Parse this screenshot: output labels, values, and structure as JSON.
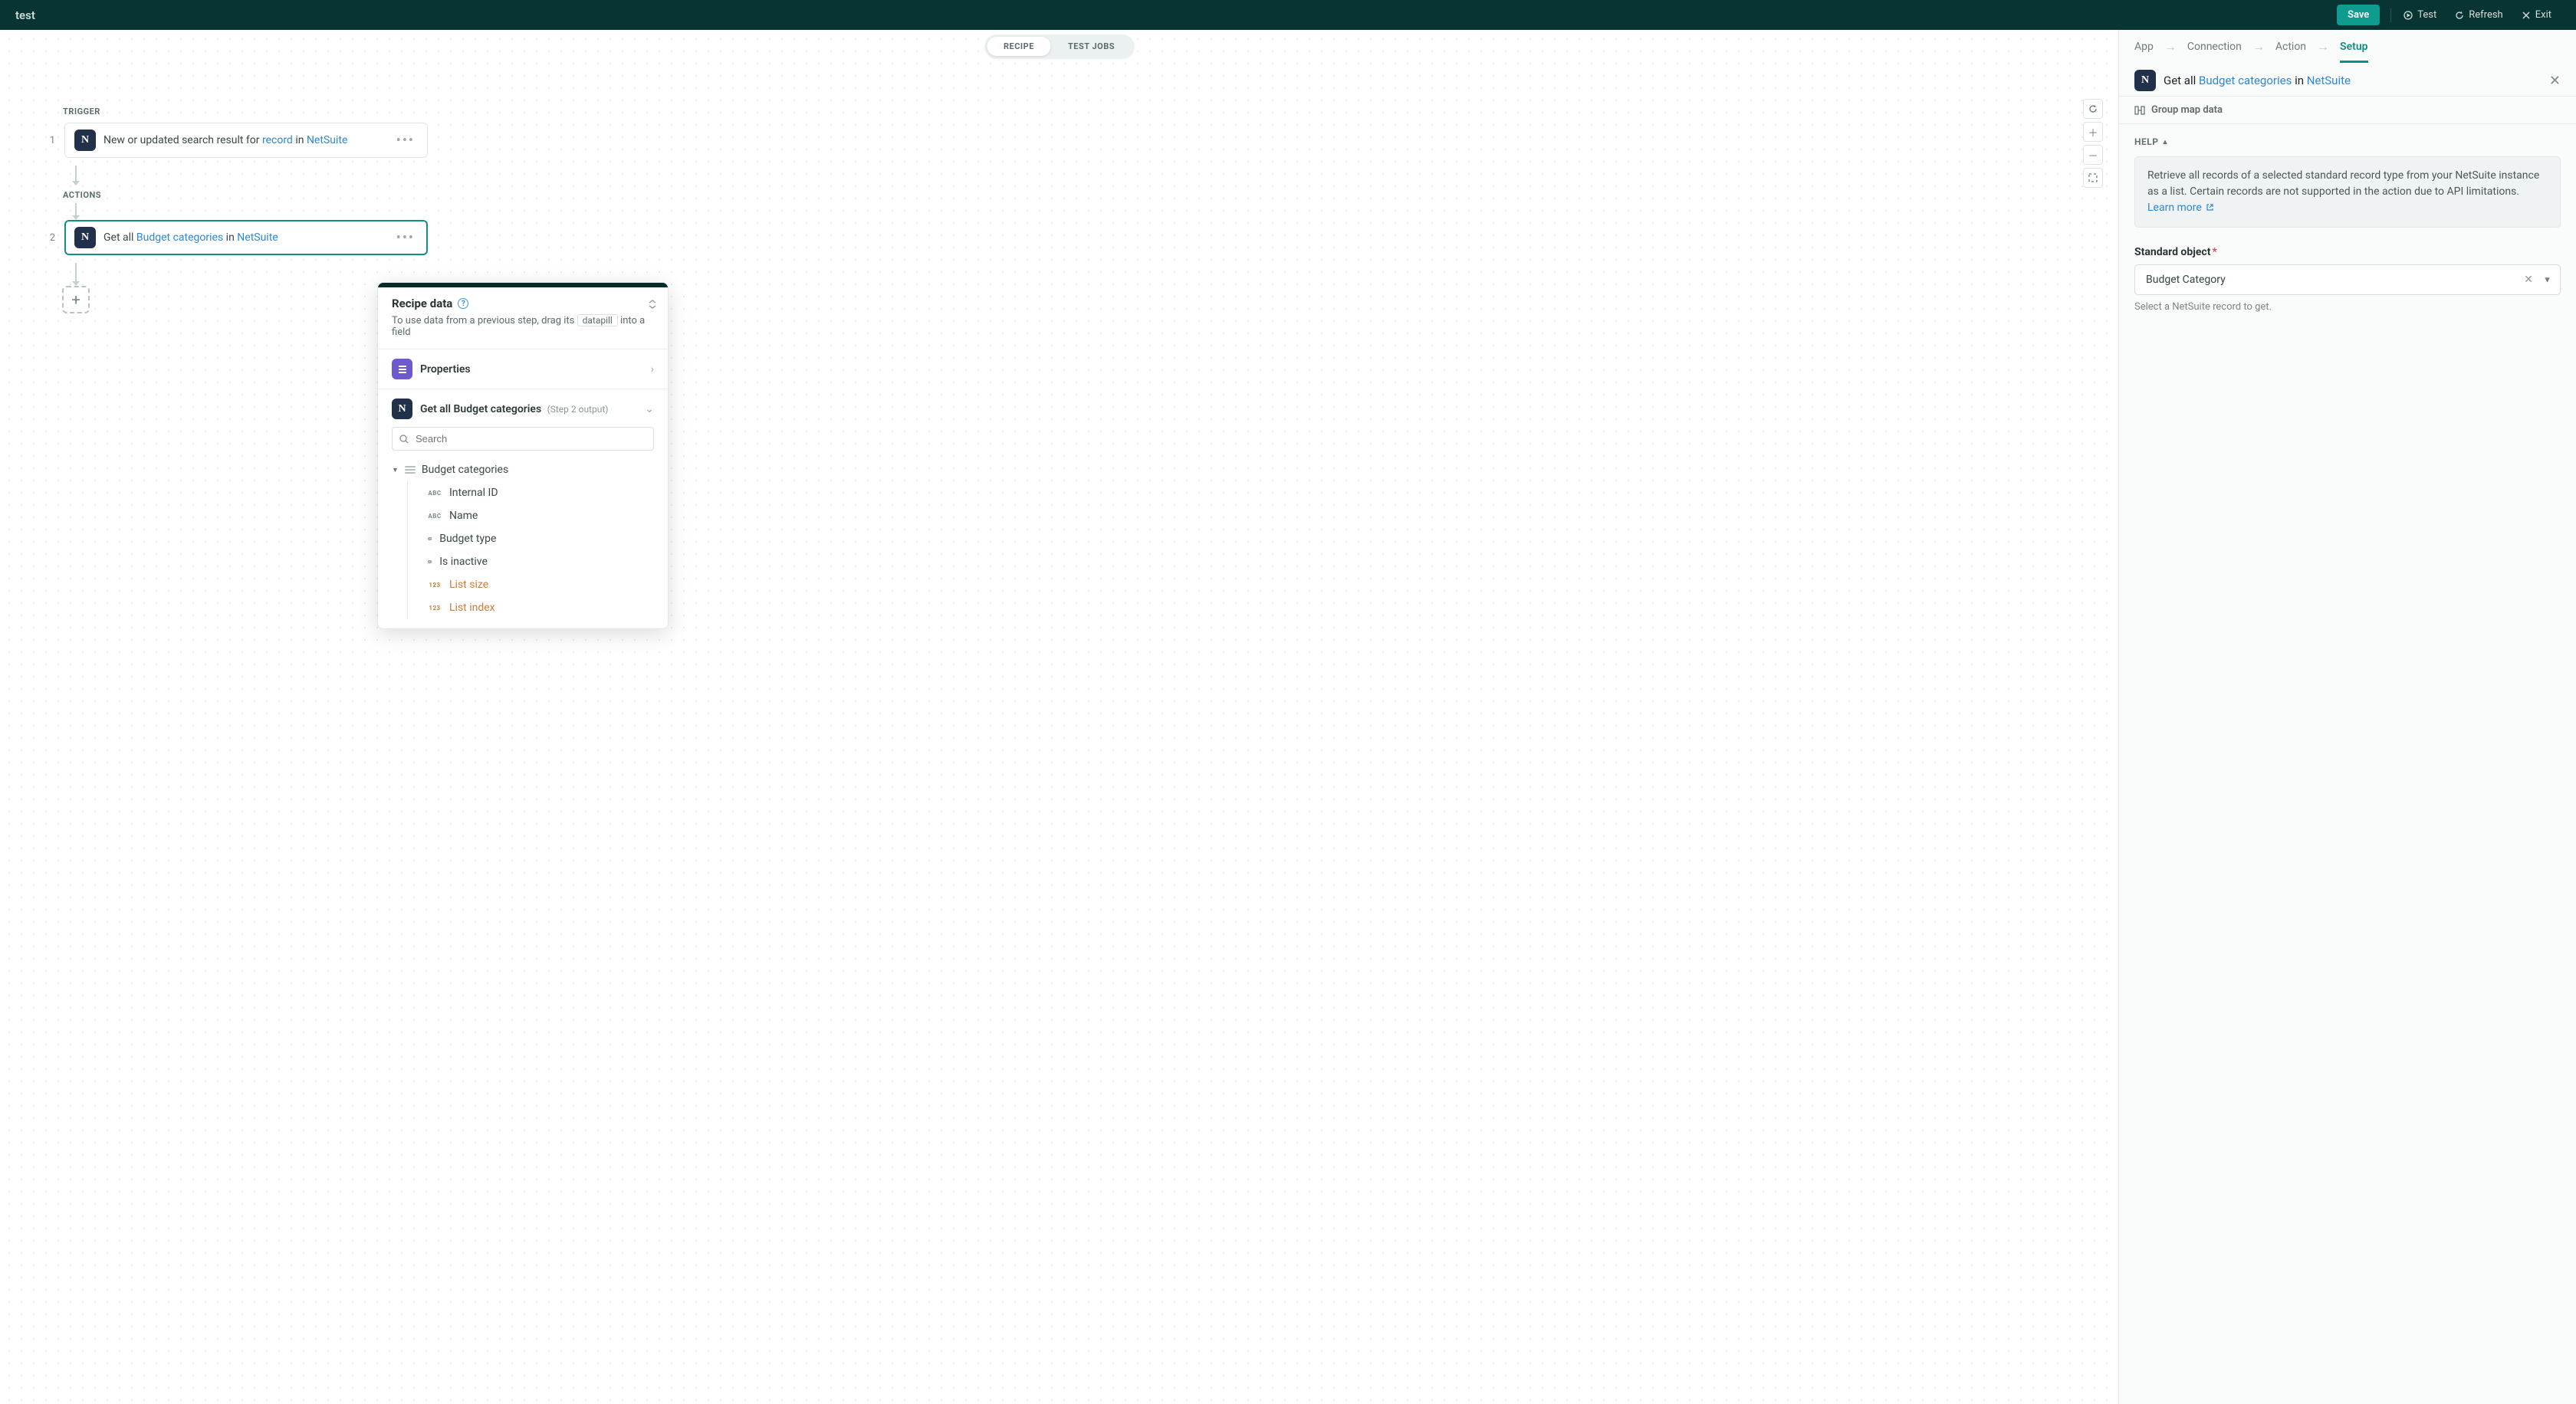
{
  "header": {
    "title": "test",
    "save": "Save",
    "test": "Test",
    "refresh": "Refresh",
    "exit": "Exit"
  },
  "tabs": {
    "recipe": "RECIPE",
    "test_jobs": "TEST JOBS"
  },
  "flow": {
    "trigger_label": "TRIGGER",
    "actions_label": "ACTIONS",
    "step1_num": "1",
    "step1_prefix": "New or updated search result for ",
    "step1_link1": "record",
    "step1_mid": " in ",
    "step1_link2": "NetSuite",
    "step2_num": "2",
    "step2_prefix": "Get all ",
    "step2_link1": "Budget categories",
    "step2_mid": " in ",
    "step2_link2": "NetSuite",
    "add": "+"
  },
  "recipe_data": {
    "title": "Recipe data",
    "subtitle_a": "To use data from a previous step, drag its",
    "pill": "datapill",
    "subtitle_b": "into a field",
    "properties": "Properties",
    "step2_label": "Get all Budget categories",
    "step2_meta": "(Step 2 output)",
    "search_placeholder": "Search",
    "tree": {
      "group": "Budget categories",
      "internal_id": "Internal ID",
      "name": "Name",
      "budget_type": "Budget type",
      "is_inactive": "Is inactive",
      "list_size": "List size",
      "list_index": "List index"
    }
  },
  "right": {
    "nav": {
      "app": "App",
      "connection": "Connection",
      "action": "Action",
      "setup": "Setup"
    },
    "title_prefix": "Get all ",
    "title_link1": "Budget categories",
    "title_mid": " in ",
    "title_link2": "NetSuite",
    "group_map": "Group map data",
    "help": "HELP",
    "help_text": "Retrieve all records of a selected standard record type from your NetSuite instance as a list. Certain records are not supported in the action due to API limitations.",
    "learn_more": "Learn more",
    "field_label": "Standard object",
    "field_value": "Budget Category",
    "field_hint": "Select a NetSuite record to get."
  }
}
